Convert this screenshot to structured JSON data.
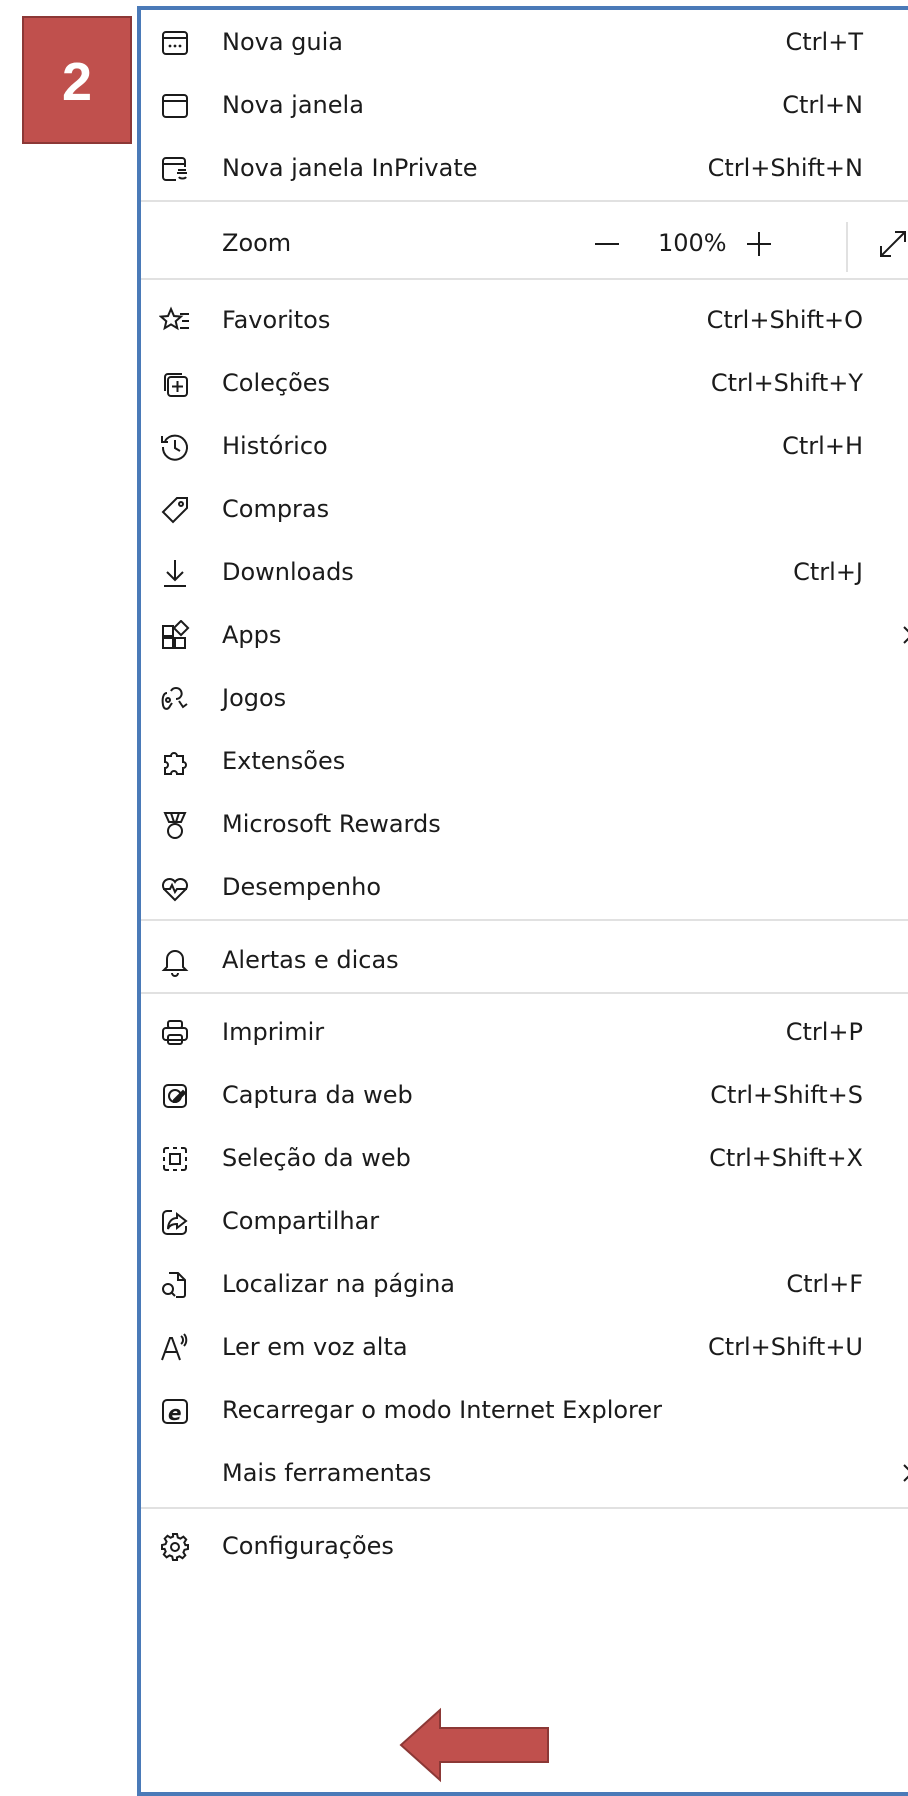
{
  "badge": {
    "number": "2",
    "color": "#c0504d"
  },
  "menu_border_color": "#4a7ab8",
  "zoom": {
    "label": "Zoom",
    "value": "100%"
  },
  "items": [
    {
      "label": "Nova guia",
      "shortcut": "Ctrl+T",
      "icon": "new-tab-icon"
    },
    {
      "label": "Nova janela",
      "shortcut": "Ctrl+N",
      "icon": "new-window-icon"
    },
    {
      "label": "Nova janela InPrivate",
      "shortcut": "Ctrl+Shift+N",
      "icon": "inprivate-icon"
    },
    {
      "label": "Favoritos",
      "shortcut": "Ctrl+Shift+O",
      "icon": "favorites-star-icon"
    },
    {
      "label": "Coleções",
      "shortcut": "Ctrl+Shift+Y",
      "icon": "collections-icon"
    },
    {
      "label": "Histórico",
      "shortcut": "Ctrl+H",
      "icon": "history-icon"
    },
    {
      "label": "Compras",
      "shortcut": "",
      "icon": "tag-icon"
    },
    {
      "label": "Downloads",
      "shortcut": "Ctrl+J",
      "icon": "download-icon"
    },
    {
      "label": "Apps",
      "shortcut": "",
      "icon": "apps-icon"
    },
    {
      "label": "Jogos",
      "shortcut": "",
      "icon": "games-icon"
    },
    {
      "label": "Extensões",
      "shortcut": "",
      "icon": "puzzle-icon"
    },
    {
      "label": "Microsoft Rewards",
      "shortcut": "",
      "icon": "rewards-medal-icon"
    },
    {
      "label": "Desempenho",
      "shortcut": "",
      "icon": "performance-heart-icon"
    },
    {
      "label": "Alertas e dicas",
      "shortcut": "",
      "icon": "bell-icon"
    },
    {
      "label": "Imprimir",
      "shortcut": "Ctrl+P",
      "icon": "printer-icon"
    },
    {
      "label": "Captura da web",
      "shortcut": "Ctrl+Shift+S",
      "icon": "web-capture-icon"
    },
    {
      "label": "Seleção da web",
      "shortcut": "Ctrl+Shift+X",
      "icon": "web-select-icon"
    },
    {
      "label": "Compartilhar",
      "shortcut": "",
      "icon": "share-icon"
    },
    {
      "label": "Localizar na página",
      "shortcut": "Ctrl+F",
      "icon": "find-page-icon"
    },
    {
      "label": "Ler em voz alta",
      "shortcut": "Ctrl+Shift+U",
      "icon": "read-aloud-icon"
    },
    {
      "label": "Recarregar o modo Internet Explorer",
      "shortcut": "",
      "icon": "ie-mode-icon"
    },
    {
      "label": "Mais ferramentas",
      "shortcut": "",
      "icon": ""
    },
    {
      "label": "Configurações",
      "shortcut": "",
      "icon": "gear-icon"
    }
  ]
}
